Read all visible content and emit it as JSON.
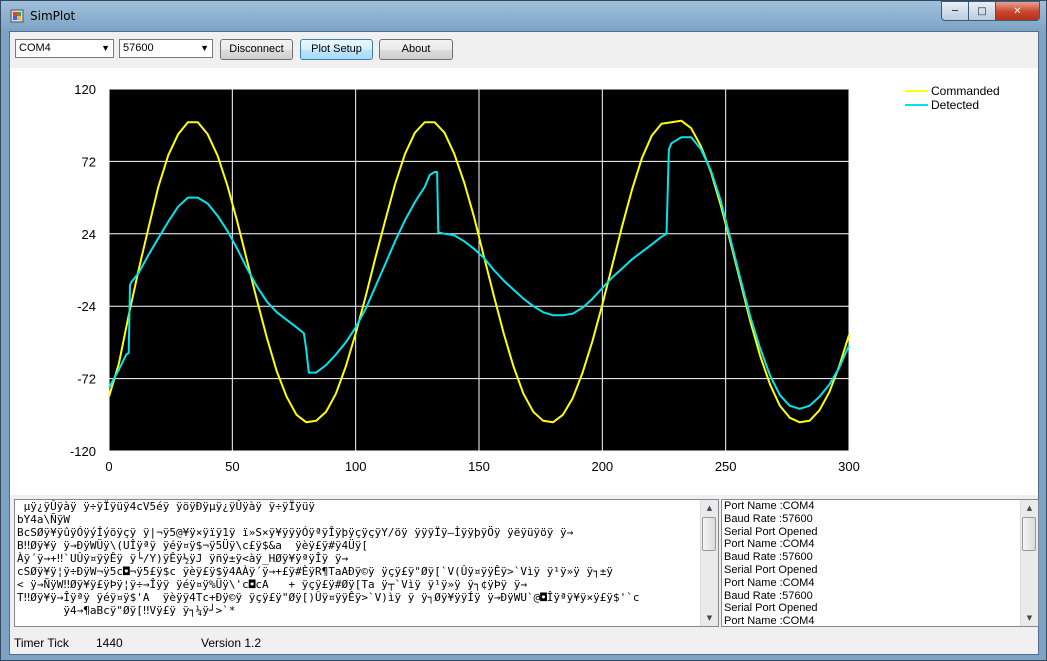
{
  "window": {
    "title": "SimPlot"
  },
  "toolbar": {
    "port": "COM4",
    "baud": "57600",
    "disconnect_label": "Disconnect",
    "plot_setup_label": "Plot Setup",
    "about_label": "About"
  },
  "chart_data": {
    "type": "line",
    "xlim": [
      0,
      300
    ],
    "ylim": [
      -120,
      120
    ],
    "x_ticks": [
      0,
      50,
      100,
      150,
      200,
      250,
      300
    ],
    "y_ticks": [
      120,
      72,
      24,
      -24,
      -72,
      -120
    ],
    "grid": true,
    "legend_position": "top-right",
    "background": "#000000",
    "series": [
      {
        "name": "Commanded",
        "color": "#ffff00",
        "points": [
          [
            0,
            -84
          ],
          [
            4,
            -62
          ],
          [
            8,
            -30
          ],
          [
            12,
            0
          ],
          [
            16,
            28
          ],
          [
            20,
            55
          ],
          [
            24,
            76
          ],
          [
            28,
            90
          ],
          [
            32,
            98
          ],
          [
            36,
            98
          ],
          [
            40,
            90
          ],
          [
            44,
            76
          ],
          [
            48,
            56
          ],
          [
            52,
            32
          ],
          [
            56,
            6
          ],
          [
            60,
            -20
          ],
          [
            64,
            -45
          ],
          [
            68,
            -67
          ],
          [
            72,
            -84
          ],
          [
            76,
            -96
          ],
          [
            80,
            -101
          ],
          [
            84,
            -100
          ],
          [
            88,
            -94
          ],
          [
            92,
            -82
          ],
          [
            96,
            -64
          ],
          [
            100,
            -42
          ],
          [
            104,
            -18
          ],
          [
            108,
            8
          ],
          [
            112,
            33
          ],
          [
            116,
            57
          ],
          [
            120,
            77
          ],
          [
            124,
            91
          ],
          [
            128,
            98
          ],
          [
            132,
            98
          ],
          [
            136,
            91
          ],
          [
            140,
            77
          ],
          [
            144,
            58
          ],
          [
            148,
            35
          ],
          [
            152,
            9
          ],
          [
            156,
            -17
          ],
          [
            160,
            -42
          ],
          [
            164,
            -64
          ],
          [
            168,
            -82
          ],
          [
            172,
            -94
          ],
          [
            176,
            -100
          ],
          [
            180,
            -101
          ],
          [
            184,
            -96
          ],
          [
            188,
            -85
          ],
          [
            192,
            -68
          ],
          [
            196,
            -47
          ],
          [
            200,
            -23
          ],
          [
            204,
            3
          ],
          [
            208,
            29
          ],
          [
            212,
            53
          ],
          [
            216,
            74
          ],
          [
            220,
            89
          ],
          [
            224,
            97
          ],
          [
            228,
            98
          ],
          [
            232,
            99
          ],
          [
            236,
            94
          ],
          [
            240,
            82
          ],
          [
            244,
            65
          ],
          [
            248,
            43
          ],
          [
            252,
            18
          ],
          [
            256,
            -8
          ],
          [
            260,
            -34
          ],
          [
            264,
            -57
          ],
          [
            268,
            -76
          ],
          [
            272,
            -90
          ],
          [
            276,
            -98
          ],
          [
            280,
            -101
          ],
          [
            284,
            -100
          ],
          [
            288,
            -93
          ],
          [
            292,
            -81
          ],
          [
            296,
            -64
          ],
          [
            300,
            -43
          ]
        ]
      },
      {
        "name": "Detected",
        "color": "#00e5ee",
        "points": [
          [
            0,
            -78
          ],
          [
            4,
            -66
          ],
          [
            7,
            -56
          ],
          [
            8,
            -55
          ],
          [
            8.5,
            -10
          ],
          [
            9,
            -8
          ],
          [
            12,
            -2
          ],
          [
            16,
            10
          ],
          [
            20,
            21
          ],
          [
            24,
            32
          ],
          [
            28,
            42
          ],
          [
            32,
            48
          ],
          [
            36,
            48
          ],
          [
            40,
            44
          ],
          [
            44,
            36
          ],
          [
            48,
            26
          ],
          [
            52,
            14
          ],
          [
            56,
            1
          ],
          [
            60,
            -11
          ],
          [
            64,
            -21
          ],
          [
            68,
            -28
          ],
          [
            72,
            -33
          ],
          [
            76,
            -38
          ],
          [
            79,
            -42
          ],
          [
            80,
            -53
          ],
          [
            81,
            -68
          ],
          [
            84,
            -68
          ],
          [
            88,
            -63
          ],
          [
            92,
            -56
          ],
          [
            96,
            -48
          ],
          [
            100,
            -38
          ],
          [
            104,
            -26
          ],
          [
            108,
            -11
          ],
          [
            112,
            4
          ],
          [
            116,
            19
          ],
          [
            120,
            33
          ],
          [
            124,
            45
          ],
          [
            128,
            55
          ],
          [
            130,
            63
          ],
          [
            132,
            65
          ],
          [
            133,
            65
          ],
          [
            133.5,
            25
          ],
          [
            136,
            24
          ],
          [
            140,
            23
          ],
          [
            144,
            19
          ],
          [
            148,
            14
          ],
          [
            152,
            8
          ],
          [
            156,
            0
          ],
          [
            160,
            -7
          ],
          [
            164,
            -13
          ],
          [
            168,
            -19
          ],
          [
            172,
            -24
          ],
          [
            176,
            -28
          ],
          [
            180,
            -30
          ],
          [
            184,
            -30
          ],
          [
            188,
            -29
          ],
          [
            192,
            -25
          ],
          [
            196,
            -19
          ],
          [
            200,
            -12
          ],
          [
            204,
            -5
          ],
          [
            208,
            1
          ],
          [
            212,
            7
          ],
          [
            216,
            12
          ],
          [
            220,
            17
          ],
          [
            224,
            22
          ],
          [
            226,
            24
          ],
          [
            227,
            80
          ],
          [
            228,
            84
          ],
          [
            232,
            88
          ],
          [
            236,
            88
          ],
          [
            240,
            80
          ],
          [
            244,
            66
          ],
          [
            248,
            46
          ],
          [
            252,
            20
          ],
          [
            256,
            -6
          ],
          [
            260,
            -31
          ],
          [
            264,
            -52
          ],
          [
            268,
            -70
          ],
          [
            272,
            -83
          ],
          [
            276,
            -90
          ],
          [
            280,
            -92
          ],
          [
            284,
            -90
          ],
          [
            288,
            -84
          ],
          [
            292,
            -76
          ],
          [
            296,
            -65
          ],
          [
            300,
            -50
          ]
        ]
      }
    ]
  },
  "log_left": {
    "lines": [
      " µÿ¿ÿÛÿàÿ ÿ÷ÿÏÿüÿ4cV5éÿ ÿöÿÐÿµÿ¿ÿÛÿàÿ ÿ÷ÿÏÿüÿ",
      "bY4a\\ÑÿW",
      "BcSØÿ¥ÿûÿÓÿýÍýöÿçÿ ÿ|¬ÿ5@¥ÿ×ÿïÿ1ÿ ï»S×ÿ¥ÿÿÿÓÿªÿÎÿþÿçÿçÿY/öÿ ÿÿÿÏÿ—ÌÿÿþÿÖÿ ÿëÿüÿöÿ ÿ→",
      "B‼Øÿ¥ÿ ÿ→ÐÿWÜÿ\\(UÎÿªÿ ÿéÿ¤ÿ$¬ÿ5Üÿ\\c£ÿ$&a  ÿèÿ£ÿ#ÿ4Üÿ[",
      "Àÿ´ÿ→+‼`UÛÿ¤ÿÿÊÿ ÿ└/Y)ÿÊÿ½ÿJ ÿñÿ±ÿ<àÿ_HØÿ¥ÿªÿÎÿ ÿ→",
      "cSØÿ¥ÿ¦ÿ÷ÐÿW¬ÿ5c◘¬ÿ5£ÿ$c ÿèÿ£ÿ$ÿ4AÀÿ´ÿ→+£ÿ#ÈÿR¶TaAÐÿ©ÿ ÿçÿ£ÿ\"Øÿ[`V(Ûÿ¤ÿÿÊÿ>`Vìÿ ÿ¹ÿ»ÿ ÿ┐±ÿ",
      "< ÿ→ÑÿW‼Øÿ¥ÿ£ÿÞÿ¦ÿ÷→Îÿÿ ÿéÿ¤ÿ%Üÿ\\'c◘cA   + ÿçÿ£ÿ#Øÿ[Ta ÿ┬`Vìÿ ÿ¹ÿ»ÿ ÿ┐¢ÿÞÿ ÿ→",
      "T‼Øÿ¥ÿ→Îÿªÿ ÿéÿ¤ÿ$'A  ÿèÿÿ4Tc+Ðÿ©ÿ ÿçÿ£ÿ\"Øÿ[)Ûÿ¤ÿÿÊÿ>`V)ìÿ ÿ ÿ┐Øÿ¥ÿÿÍÿ ÿ→ÐÿWU`@◘Îÿªÿ¥ÿ×ÿ£ÿ$'`c",
      "       ÿ4→¶aBcÿ\"Øÿ[‼Vÿ£ÿ ÿ┐¼ÿ┘>`*"
    ]
  },
  "log_right": {
    "lines": [
      "Port Name :COM4",
      "Baud Rate :57600",
      "Serial Port Opened",
      "Port Name :COM4",
      "Baud Rate :57600",
      "Serial Port Opened",
      "Port Name :COM4",
      "Baud Rate :57600",
      "Serial Port Opened",
      "Port Name :COM4"
    ]
  },
  "status": {
    "timer_label": "Timer Tick",
    "timer_value": "1440",
    "version_label": "Version  1.2"
  }
}
